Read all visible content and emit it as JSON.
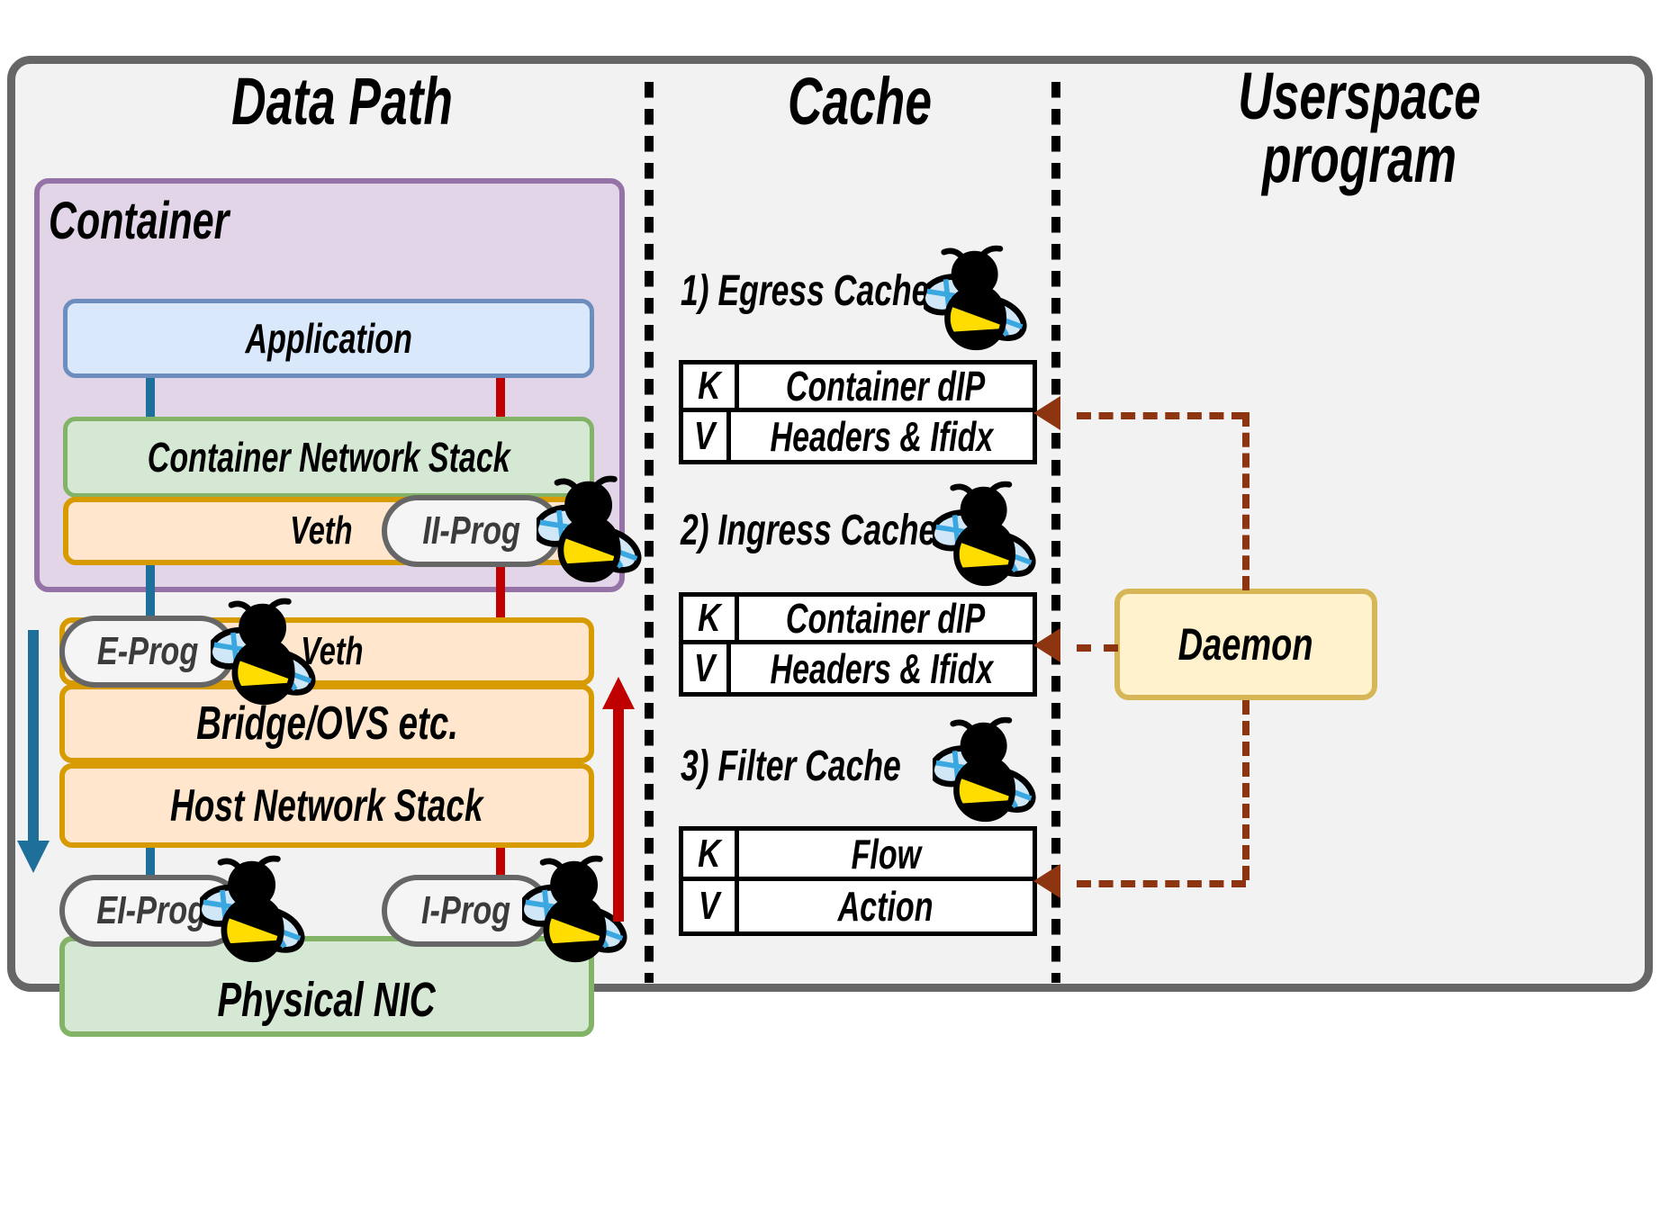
{
  "columns": {
    "data_path_title": "Data Path",
    "cache_title": "Cache",
    "userspace_title": "Userspace\nprogram"
  },
  "data_path": {
    "container_label": "Container",
    "application": "Application",
    "container_network_stack": "Container Network Stack",
    "veth_inner": "Veth",
    "veth_outer": "Veth",
    "bridge": "Bridge/OVS etc.",
    "host_network_stack": "Host Network Stack",
    "physical_nic": "Physical NIC",
    "progs": {
      "ii_prog": "II-Prog",
      "e_prog": "E-Prog",
      "ei_prog": "EI-Prog",
      "i_prog": "I-Prog"
    }
  },
  "cache": {
    "sections": [
      {
        "heading": "1) Egress Cache",
        "key_label": "K",
        "key_value": "Container dIP",
        "value_label": "V",
        "value_value": "Headers & Ifidx"
      },
      {
        "heading": "2) Ingress Cache",
        "key_label": "K",
        "key_value": "Container dIP",
        "value_label": "V",
        "value_value": "Headers & Ifidx"
      },
      {
        "heading": "3) Filter Cache",
        "key_label": "K",
        "key_value": "Flow",
        "value_label": "V",
        "value_value": "Action"
      }
    ]
  },
  "userspace": {
    "daemon_label": "Daemon"
  },
  "icons": {
    "bee": "bee-icon"
  },
  "colors": {
    "frame_border": "#666666",
    "frame_fill": "#f2f2f2",
    "container_fill": "#e1d5e7",
    "container_border": "#9673a6",
    "app_fill": "#dae8fc",
    "app_border": "#6c8ebf",
    "green_fill": "#d5e8d4",
    "green_border": "#82b366",
    "orange_fill": "#ffe6cc",
    "orange_border": "#d79b00",
    "pill_fill": "#f5f5f5",
    "pill_border": "#666666",
    "daemon_fill": "#fff2cc",
    "daemon_border": "#d6b656",
    "egress_line": "#1f6f9b",
    "ingress_line": "#c00000",
    "daemon_arrow": "#8c3510",
    "bee_body": "#000000",
    "bee_abdomen": "#ffdd00",
    "bee_wing": "#cfe7f7"
  }
}
